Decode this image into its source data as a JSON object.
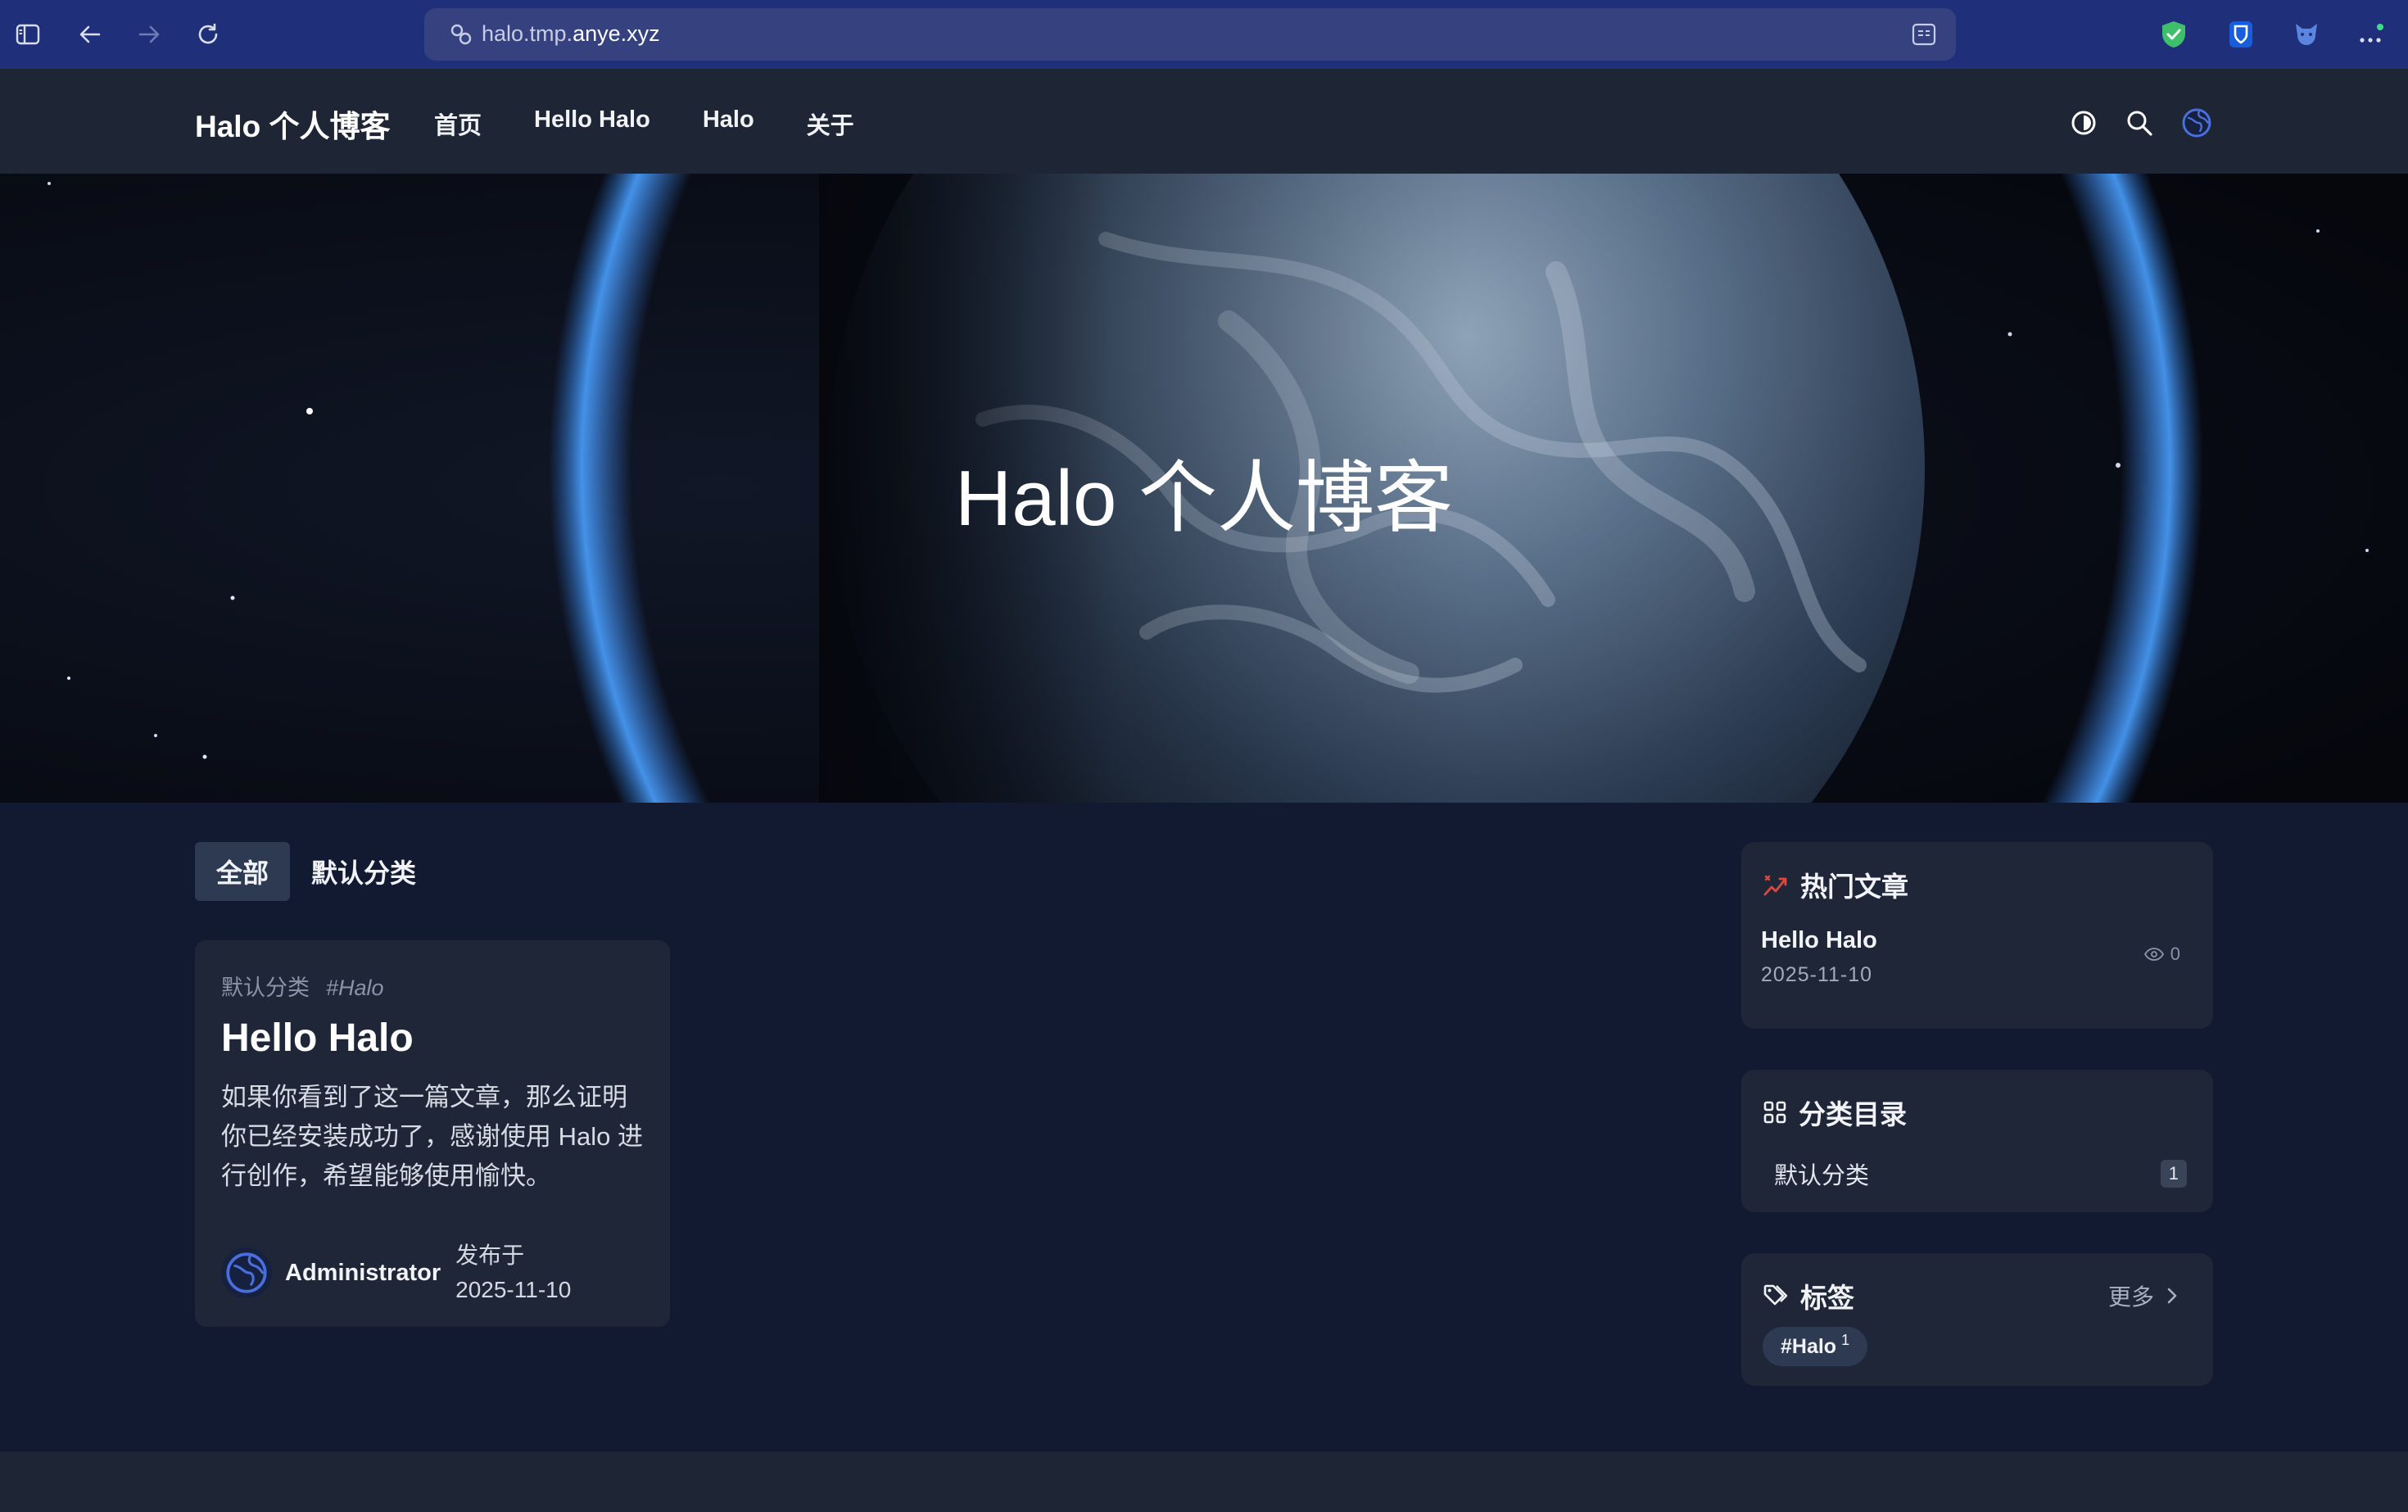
{
  "browser": {
    "url_prefix": "halo.tmp.",
    "url_domain": "anye.xyz"
  },
  "site": {
    "brand": "Halo 个人博客",
    "nav": [
      "首页",
      "Hello Halo",
      "Halo",
      "关于"
    ]
  },
  "hero": {
    "title": "Halo 个人博客"
  },
  "tabs": [
    {
      "label": "全部",
      "active": true
    },
    {
      "label": "默认分类",
      "active": false
    }
  ],
  "post": {
    "category": "默认分类",
    "tag": "#Halo",
    "title": "Hello Halo",
    "excerpt": "如果你看到了这一篇文章，那么证明你已经安装成功了，感谢使用 Halo 进行创作，希望能够使用愉快。",
    "author": "Administrator",
    "published_label": "发布于",
    "published_date": "2025-11-10"
  },
  "sidebar": {
    "popular": {
      "title": "热门文章",
      "item_title": "Hello Halo",
      "item_date": "2025-11-10",
      "item_views": "0"
    },
    "categories": {
      "title": "分类目录",
      "item_name": "默认分类",
      "item_count": "1"
    },
    "tags": {
      "title": "标签",
      "more_label": "更多",
      "chip_label": "#Halo",
      "chip_count": "1"
    }
  },
  "colors": {
    "chrome_bg": "#1f2f7a",
    "header_bg": "#1e2535",
    "page_bg": "#111a30",
    "card_bg": "#1e2638",
    "accent": "#4a6fdc",
    "hot_icon": "#e0473f"
  }
}
